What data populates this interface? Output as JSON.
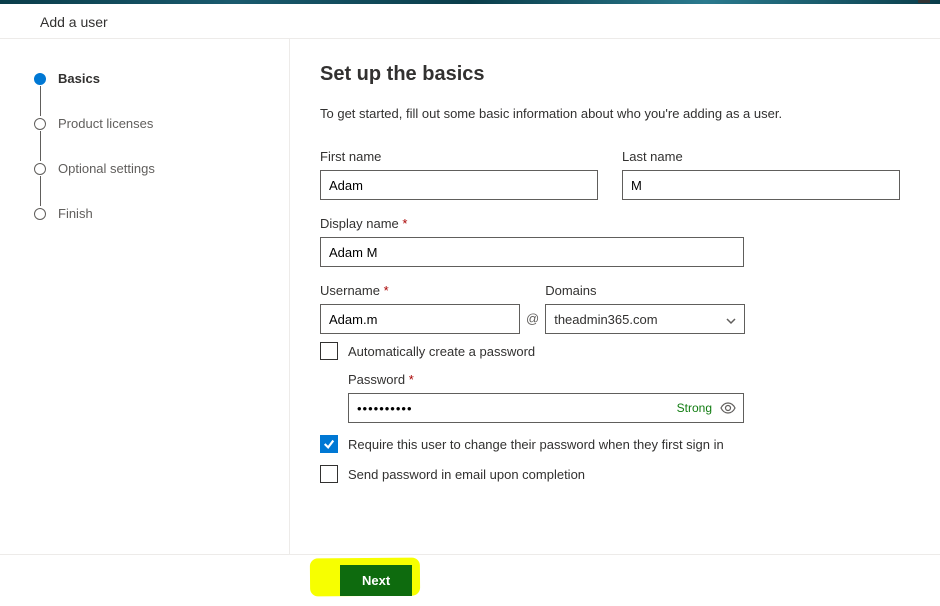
{
  "header": {
    "title": "Add a user"
  },
  "steps": [
    {
      "label": "Basics",
      "active": true
    },
    {
      "label": "Product licenses",
      "active": false
    },
    {
      "label": "Optional settings",
      "active": false
    },
    {
      "label": "Finish",
      "active": false
    }
  ],
  "main": {
    "title": "Set up the basics",
    "subtitle": "To get started, fill out some basic information about who you're adding as a user.",
    "labels": {
      "first_name": "First name",
      "last_name": "Last name",
      "display_name": "Display name",
      "username": "Username",
      "domains": "Domains",
      "password": "Password"
    },
    "values": {
      "first_name": "Adam",
      "last_name": "M",
      "display_name": "Adam M",
      "username": "Adam.m",
      "domain": "theadmin365.com",
      "password": "••••••••••",
      "strength": "Strong"
    },
    "checkboxes": {
      "auto_password": {
        "label": "Automatically create a password",
        "checked": false
      },
      "require_change": {
        "label": "Require this user to change their password when they first sign in",
        "checked": true
      },
      "send_email": {
        "label": "Send password in email upon completion",
        "checked": false
      }
    }
  },
  "footer": {
    "next": "Next"
  }
}
